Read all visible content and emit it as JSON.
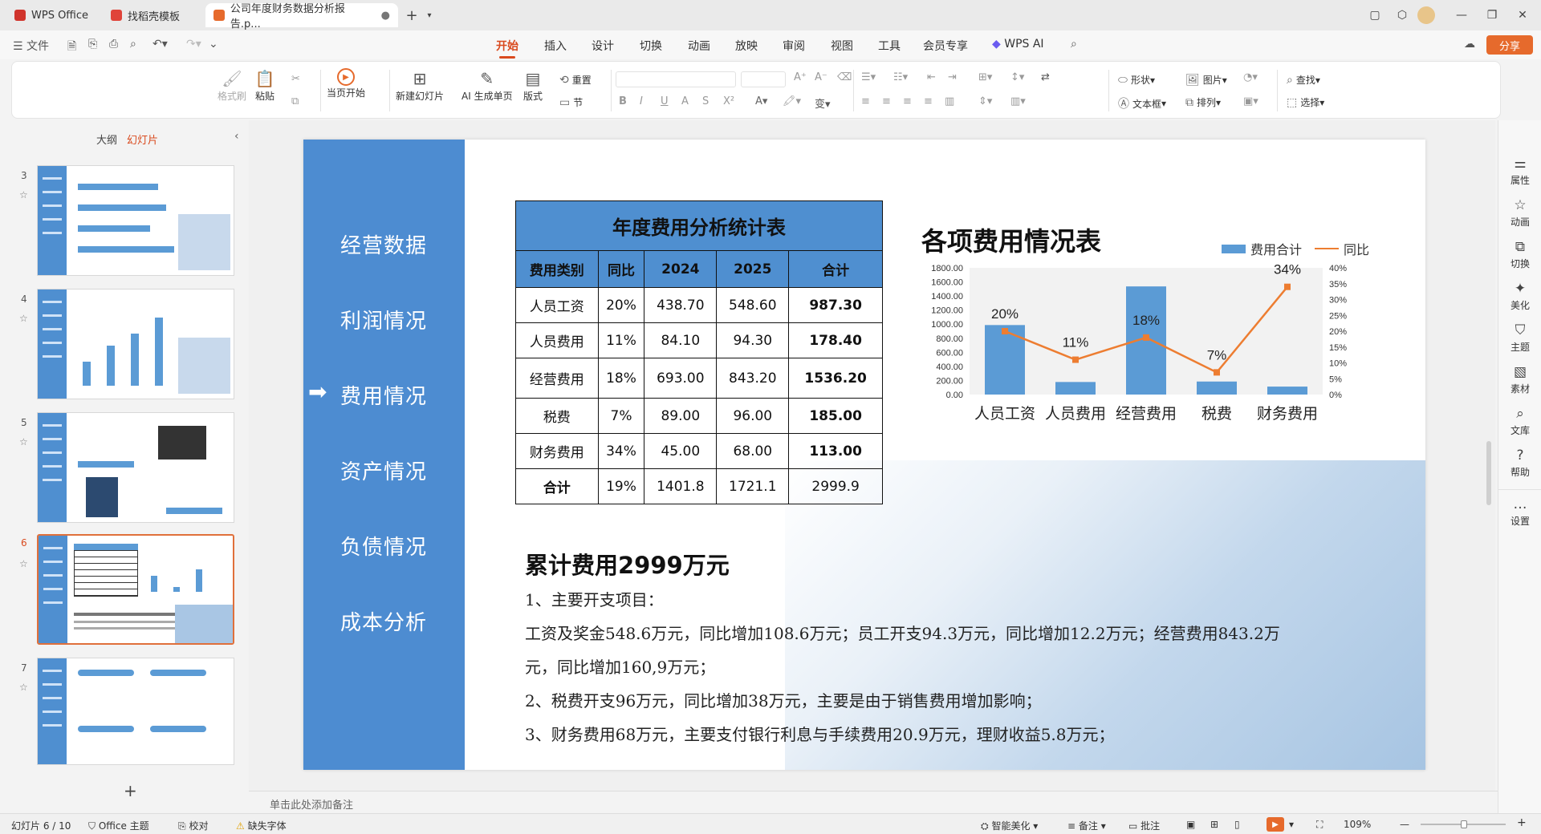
{
  "tabs": [
    {
      "label": "WPS Office"
    },
    {
      "label": "找稻壳模板"
    },
    {
      "label": "公司年度财务数据分析报告.p..."
    }
  ],
  "menu": {
    "file": "文件",
    "items": [
      "开始",
      "插入",
      "设计",
      "切换",
      "动画",
      "放映",
      "审阅",
      "视图",
      "工具",
      "会员专享",
      "WPS AI"
    ],
    "share": "分享"
  },
  "ribbon": {
    "format_brush": "格式刷",
    "paste": "粘贴",
    "play_current": "当页开始",
    "new_slide": "新建幻灯片",
    "ai_slide": "AI 生成单页",
    "layout": "版式",
    "reset": "重置",
    "section": "节",
    "shape": "形状",
    "textbox": "文本框",
    "picture": "图片",
    "arrange": "排列",
    "find": "查找",
    "select": "选择"
  },
  "left_panel": {
    "tab_outline": "大纲",
    "tab_slides": "幻灯片",
    "slide_numbers": [
      "3",
      "4",
      "5",
      "6",
      "7"
    ],
    "add": "+"
  },
  "slide": {
    "nav": [
      "经营数据",
      "利润情况",
      "费用情况",
      "资产情况",
      "负债情况",
      "成本分析"
    ],
    "table": {
      "title": "年度费用分析统计表",
      "headers": [
        "费用类别",
        "同比",
        "2024",
        "2025",
        "合计"
      ],
      "rows": [
        [
          "人员工资",
          "20%",
          "438.70",
          "548.60",
          "987.30"
        ],
        [
          "人员费用",
          "11%",
          "84.10",
          "94.30",
          "178.40"
        ],
        [
          "经营费用",
          "18%",
          "693.00",
          "843.20",
          "1536.20"
        ],
        [
          "税费",
          "7%",
          "89.00",
          "96.00",
          "185.00"
        ],
        [
          "财务费用",
          "34%",
          "45.00",
          "68.00",
          "113.00"
        ]
      ],
      "total": [
        "合计",
        "19%",
        "1401.8",
        "1721.1",
        "2999.9"
      ]
    },
    "chart_title": "各项费用情况表",
    "summary_title": "累计费用2999万元",
    "body": [
      "1、主要开支项目：",
      "工资及奖金548.6万元，同比增加108.6万元；员工开支94.3万元，同比增加12.2万元；经营费用843.2万",
      "元，同比增加160,9万元；",
      "2、税费开支96万元，同比增加38万元，主要是由于销售费用增加影响；",
      "3、财务费用68万元，主要支付银行利息与手续费用20.9万元，理财收益5.8万元；"
    ]
  },
  "chart_data": {
    "type": "bar",
    "categories": [
      "人员工资",
      "人员费用",
      "经营费用",
      "税费",
      "财务费用"
    ],
    "series": [
      {
        "name": "费用合计",
        "type": "bar",
        "values": [
          987.3,
          178.4,
          1536.2,
          185.0,
          113.0
        ],
        "color": "#5b9bd5"
      },
      {
        "name": "同比",
        "type": "line",
        "values": [
          20,
          11,
          18,
          7,
          34
        ],
        "labels": [
          "20%",
          "11%",
          "18%",
          "7%",
          "34%"
        ],
        "color": "#ed7d31"
      }
    ],
    "y_ticks": [
      "1800.00",
      "1600.00",
      "1400.00",
      "1200.00",
      "1000.00",
      "800.00",
      "600.00",
      "400.00",
      "200.00",
      "0.00"
    ],
    "y2_ticks": [
      "40%",
      "35%",
      "30%",
      "25%",
      "20%",
      "15%",
      "10%",
      "5%",
      "0%"
    ],
    "ylim": [
      0,
      1800
    ],
    "y2lim": [
      0,
      40
    ],
    "legend": "top-right"
  },
  "right_panel": [
    "属性",
    "动画",
    "切换",
    "美化",
    "主题",
    "素材",
    "文库",
    "帮助",
    "设置"
  ],
  "notes_placeholder": "单击此处添加备注",
  "status": {
    "slide": "幻灯片 6 / 10",
    "theme": "Office 主题",
    "proof": "校对",
    "missing_font": "缺失字体",
    "smart": "智能美化",
    "notes": "备注",
    "comment": "批注",
    "zoom": "109%"
  },
  "colors": {
    "accent": "#d94a1e",
    "slide_blue": "#4d8cd1"
  }
}
